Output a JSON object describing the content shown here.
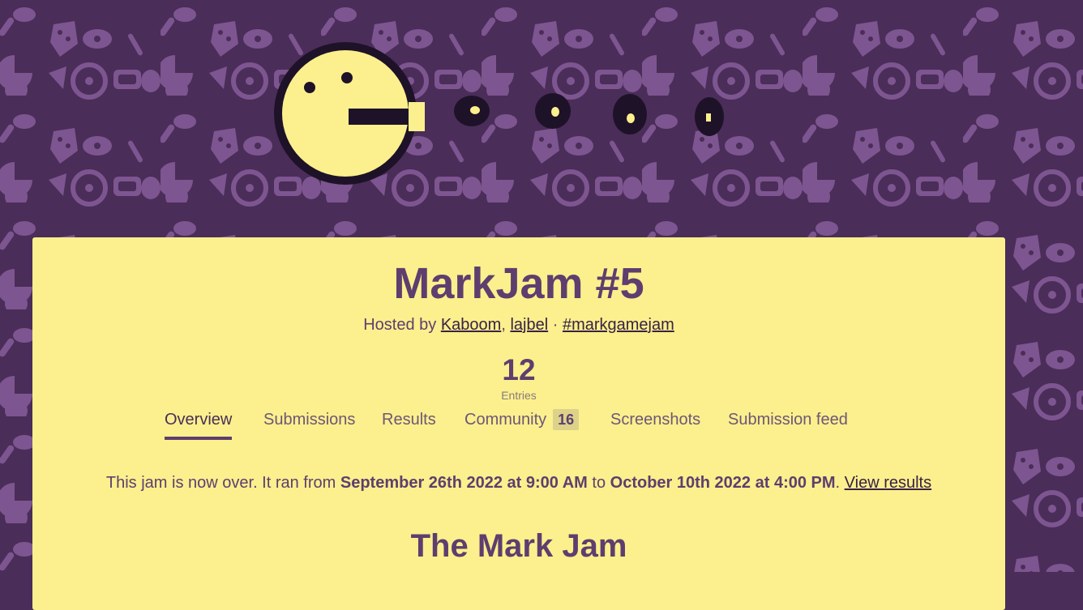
{
  "jam": {
    "title": "MarkJam #5",
    "hosted_prefix": "Hosted by",
    "hosts": [
      "Kaboom",
      "lajbel"
    ],
    "host_separator": ",",
    "dot_separator": "·",
    "hashtag": "#markgamejam"
  },
  "stats": {
    "entries_value": "12",
    "entries_label": "Entries"
  },
  "tabs": [
    {
      "label": "Overview",
      "active": true
    },
    {
      "label": "Submissions"
    },
    {
      "label": "Results"
    },
    {
      "label": "Community",
      "count": "16"
    },
    {
      "label": "Screenshots"
    },
    {
      "label": "Submission feed"
    }
  ],
  "status": {
    "prefix": "This jam is now over. It ran from",
    "start": "September 26th 2022 at 9:00 AM",
    "middle": "to",
    "end": "October 10th 2022 at 4:00 PM",
    "period": ".",
    "link": "View results"
  },
  "content": {
    "section_title": "The Mark Jam"
  },
  "colors": {
    "page_bg": "#4a2d58",
    "pattern": "#7d5590",
    "card_bg": "#fbf08d",
    "text": "#5e3e6e",
    "mascot_fill": "#fbf08d",
    "mascot_outline": "#1e1228"
  }
}
